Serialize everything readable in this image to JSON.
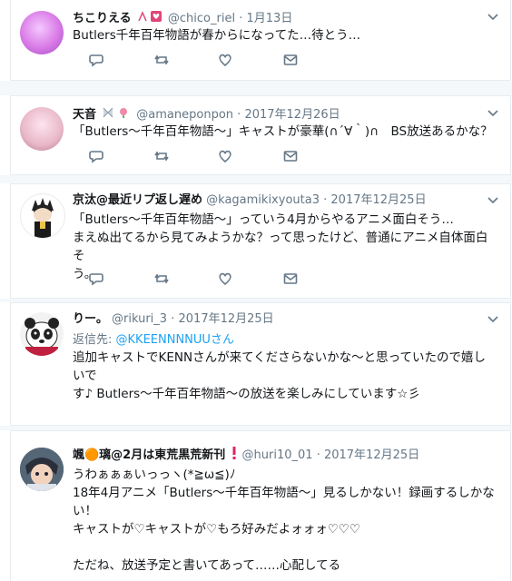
{
  "tweets": [
    {
      "name": "ちこりえる",
      "handle": "@chico_riel",
      "time": "1月13日",
      "text": "Butlers千年百年物語が春からになってた…待とう…",
      "avatar_color": "#d97ae6"
    },
    {
      "name": "天音",
      "handle": "@amaneponpon",
      "time": "2017年12月26日",
      "text": "「Butlers〜千年百年物語〜」キャストが豪華(∩´∀｀)∩　BS放送あるかな？",
      "avatar_color": "#e8b7c8"
    },
    {
      "name": "京汰@最近リプ返し遅め",
      "handle": "@kagamikixyouta3",
      "time": "2017年12月25日",
      "text_lines": [
        "「Butlers〜千年百年物語〜」っていう4月からやるアニメ面白そう…",
        "まえぬ出てるから見てみようかな？って思ったけど、普通にアニメ自体面白そ",
        "う。"
      ],
      "avatar_color": "#3a3a3a"
    },
    {
      "name": "りー。",
      "handle": "@rikuri_3",
      "time": "2017年12月25日",
      "reply_prefix": "返信先:",
      "reply_target": "@KKEENNNNUUさん",
      "text_lines": [
        "追加キャストでKENNさんが来てくださらないかな〜と思っていたので嬉しいで",
        "す♪ Butlers〜千年百年物語〜の放送を楽しみにしています☆彡"
      ],
      "avatar_color": "#222222"
    },
    {
      "name": "颯🟠璃@2月は東荒黒荒新刊",
      "handle": "@huri10_01",
      "time": "2017年12月25日",
      "text_lines": [
        "うわぁぁぁいっっヽ(*≧ω≦)ﾉ",
        "18年4月アニメ「Butlers〜千年百年物語〜」見るしかない！録画するしかな",
        "い！",
        "キャストが♡キャストが♡もろ好みだよォォォ♡♡♡",
        "",
        "ただね、放送予定と書いてあって……心配してる"
      ],
      "avatar_color": "#556677"
    }
  ],
  "sep": "·",
  "icons": [
    "reply-icon",
    "retweet-icon",
    "like-icon",
    "dm-icon",
    "chevron-down-icon"
  ]
}
